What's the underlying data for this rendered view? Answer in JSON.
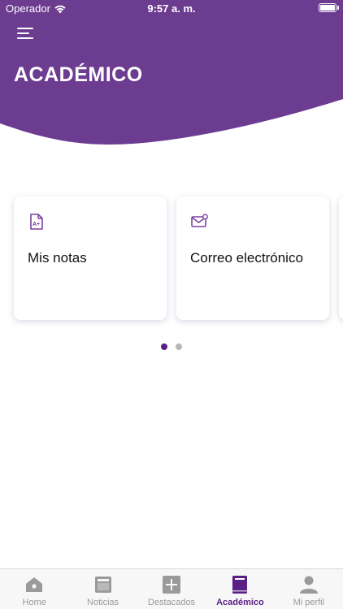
{
  "colors": {
    "brand_purple": "#6c3c91",
    "active_tab": "#5a1f86",
    "inactive_tab": "#9a9a9a",
    "icon_purple": "#7a3fa1"
  },
  "status_bar": {
    "carrier": "Operador",
    "time": "9:57 a. m.",
    "battery": "full"
  },
  "header": {
    "menu_icon": "hamburger-menu-icon",
    "title": "ACADÉMICO"
  },
  "cards": [
    {
      "icon": "grade-document-icon",
      "label": "Mis notas"
    },
    {
      "icon": "email-envelope-icon",
      "label": "Correo electrónico"
    }
  ],
  "pager": {
    "total_pages": 2,
    "active_page": 1
  },
  "tab_bar": {
    "active_index": 3,
    "tabs": [
      {
        "icon": "home-icon",
        "label": "Home"
      },
      {
        "icon": "news-icon",
        "label": "Noticias"
      },
      {
        "icon": "add-icon",
        "label": "Destacados"
      },
      {
        "icon": "book-icon",
        "label": "Académico"
      },
      {
        "icon": "profile-icon",
        "label": "Mi perfil"
      }
    ]
  }
}
